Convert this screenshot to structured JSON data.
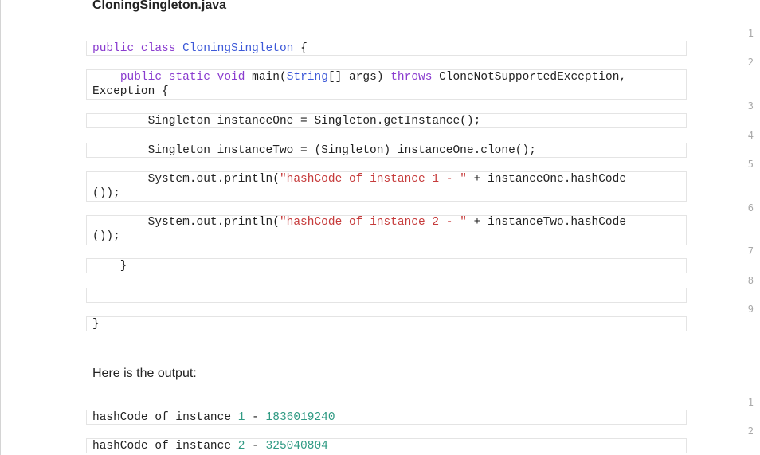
{
  "document": {
    "title": "CloningSingleton.java",
    "output_heading": "Here is the output:"
  },
  "code_block": {
    "lines": [
      {
        "number": "1",
        "tokens": {
          "kw_public": "public",
          "kw_class": "class",
          "class_name": "CloningSingleton",
          "brace": "{"
        }
      },
      {
        "number": "2",
        "tokens": {
          "indent": "    ",
          "kw_public": "public",
          "kw_static": "static",
          "kw_void": "void",
          "method_name": "main(",
          "type_string": "String",
          "params": "[] args)",
          "kw_throws": "throws",
          "exceptions_line1": "CloneNotSupportedException,",
          "exceptions_line2": "Exception {"
        }
      },
      {
        "number": "3",
        "text": "        Singleton instanceOne = Singleton.getInstance();"
      },
      {
        "number": "4",
        "text": "        Singleton instanceTwo = (Singleton) instanceOne.clone();"
      },
      {
        "number": "5",
        "tokens": {
          "prefix": "        System.out.println(",
          "string": "\"hashCode of instance 1 - \"",
          "suffix": " + instanceOne.hashCode",
          "wrap": "());"
        }
      },
      {
        "number": "6",
        "tokens": {
          "prefix": "        System.out.println(",
          "string": "\"hashCode of instance 2 - \"",
          "suffix": " + instanceTwo.hashCode",
          "wrap": "());"
        }
      },
      {
        "number": "7",
        "text": "    }"
      },
      {
        "number": "8",
        "text": ""
      },
      {
        "number": "9",
        "text": "}"
      }
    ]
  },
  "output_block": {
    "lines": [
      {
        "number": "1",
        "tokens": {
          "label": "hashCode of instance ",
          "instance": "1",
          "separator": " - ",
          "value": "1836019240"
        }
      },
      {
        "number": "2",
        "tokens": {
          "label": "hashCode of instance ",
          "instance": "2",
          "separator": " - ",
          "value": "325040804"
        }
      }
    ]
  },
  "colors": {
    "keyword": "#8a3ccf",
    "type": "#3d59d8",
    "string": "#c63b3b",
    "number": "#2f9a83",
    "line_number": "#a9a9a9",
    "border": "#e4e4e4"
  }
}
